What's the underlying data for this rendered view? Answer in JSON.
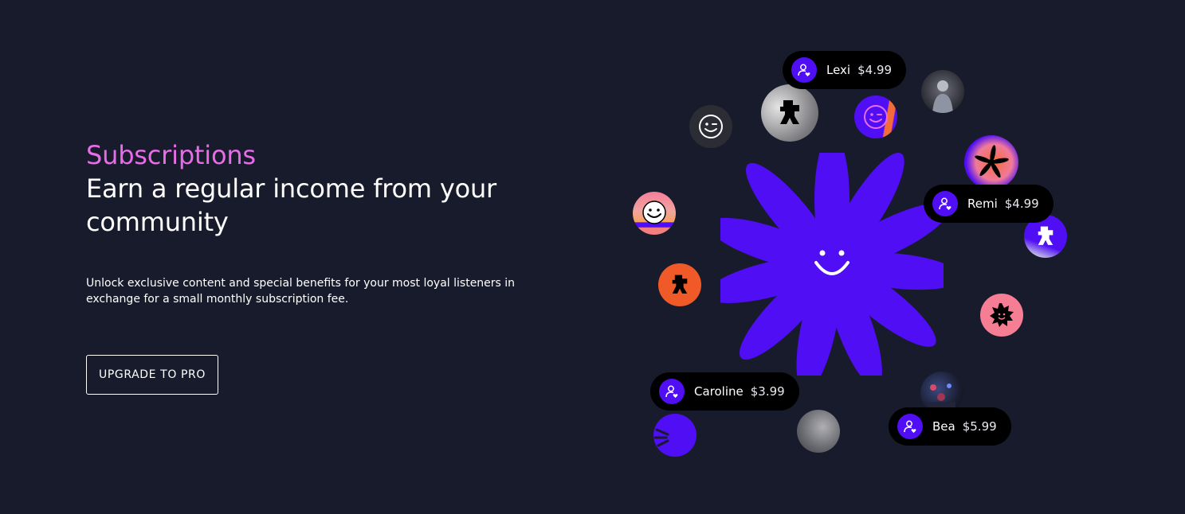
{
  "hero": {
    "eyebrow": "Subscriptions",
    "headline": "Earn a regular income from your community",
    "description": "Unlock exclusive content and special benefits for your most loyal listeners in exchange for a small monthly subscription fee.",
    "cta_label": "UPGRADE TO PRO"
  },
  "subscribers": [
    {
      "name": "Lexi",
      "price": "$4.99"
    },
    {
      "name": "Remi",
      "price": "$4.99"
    },
    {
      "name": "Caroline",
      "price": "$3.99"
    },
    {
      "name": "Bea",
      "price": "$5.99"
    }
  ],
  "icons": {
    "subscriber_badge": "user-heart-icon",
    "center": "smiling-flower-icon"
  },
  "colors": {
    "background": "#181b2b",
    "accent_pink": "#e86ce8",
    "brand_purple": "#4f0ef3",
    "pill_bg": "#000000",
    "orange": "#f05a28",
    "coral": "#f57e7e"
  }
}
